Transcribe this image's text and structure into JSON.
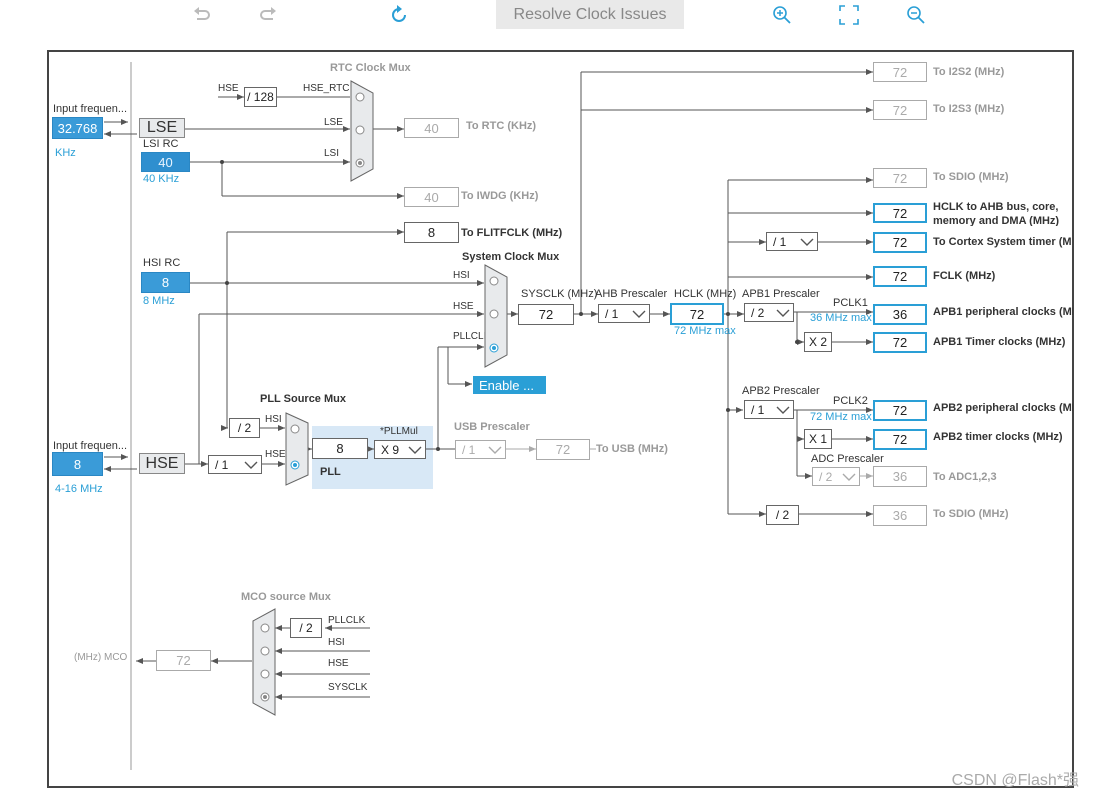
{
  "toolbar": {
    "undo_icon": "undo-icon",
    "redo_icon": "redo-icon",
    "refresh_icon": "refresh-icon",
    "resolve_label": "Resolve Clock Issues",
    "zoom_in_icon": "zoom-in-icon",
    "fit_icon": "fit-icon",
    "zoom_out_icon": "zoom-out-icon"
  },
  "inputs": {
    "lse_input_label": "Input frequen...",
    "lse_value": "32.768",
    "lse_unit": "KHz",
    "lse_name": "LSE",
    "lsi_rc_label": "LSI RC",
    "lsi_value": "40",
    "lsi_unit": "40 KHz",
    "hsi_rc_label": "HSI RC",
    "hsi_value": "8",
    "hsi_unit": "8 MHz",
    "hse_input_label": "Input frequen...",
    "hse_value": "8",
    "hse_unit": "4-16 MHz",
    "hse_name": "HSE"
  },
  "rtc": {
    "title": "RTC Clock Mux",
    "hse_label": "HSE",
    "div128": "/ 128",
    "hse_rtc": "HSE_RTC",
    "lse": "LSE",
    "lsi": "LSI",
    "rtc_value": "40",
    "rtc_label": "To RTC (KHz)",
    "iwdg_value": "40",
    "iwdg_label": "To IWDG (KHz)",
    "flit_value": "8",
    "flit_label": "To FLITFCLK (MHz)"
  },
  "sysmux": {
    "title": "System Clock Mux",
    "hsi": "HSI",
    "hse": "HSE",
    "pllclk": "PLLCLK",
    "enable": "Enable ..."
  },
  "pll": {
    "source_title": "PLL Source Mux",
    "div2": "/ 2",
    "hsi": "HSI",
    "hse": "HSE",
    "hse_div": "/ 1",
    "pll_in": "8",
    "pllmul_label": "*PLLMul",
    "pllmul": "X 9",
    "pll_label": "PLL",
    "usb_title": "USB Prescaler",
    "usb_div": "/ 1",
    "usb_value": "72",
    "usb_label": "To USB (MHz)"
  },
  "main": {
    "sysclk_label": "SYSCLK (MHz)",
    "sysclk": "72",
    "ahb_title": "AHB Prescaler",
    "ahb_div": "/ 1",
    "hclk_label": "HCLK (MHz)",
    "hclk": "72",
    "hclk_max": "72 MHz max"
  },
  "outputs": {
    "i2s2_value": "72",
    "i2s2_label": "To I2S2 (MHz)",
    "i2s3_value": "72",
    "i2s3_label": "To I2S3 (MHz)",
    "sdio1_value": "72",
    "sdio1_label": "To SDIO (MHz)",
    "ahb_value": "72",
    "ahb_label_1": "HCLK to AHB bus, core,",
    "ahb_label_2": "memory and DMA (MHz)",
    "cortex_div": "/ 1",
    "cortex_value": "72",
    "cortex_label": "To Cortex System timer (M",
    "fclk_value": "72",
    "fclk_label": "FCLK (MHz)",
    "apb1_title": "APB1 Prescaler",
    "apb1_div": "/ 2",
    "pclk1": "PCLK1",
    "pclk1_max": "36 MHz max",
    "apb1_periph_value": "36",
    "apb1_periph_label": "APB1 peripheral clocks (MH",
    "apb1_x2": "X 2",
    "apb1_timer_value": "72",
    "apb1_timer_label": "APB1 Timer clocks (MHz)",
    "apb2_title": "APB2 Prescaler",
    "apb2_div": "/ 1",
    "pclk2": "PCLK2",
    "pclk2_max": "72 MHz max",
    "apb2_periph_value": "72",
    "apb2_periph_label": "APB2 peripheral clocks (MH",
    "apb2_x1": "X 1",
    "apb2_timer_value": "72",
    "apb2_timer_label": "APB2 timer clocks (MHz)",
    "adc_title": "ADC Prescaler",
    "adc_div": "/ 2",
    "adc_value": "36",
    "adc_label": "To ADC1,2,3",
    "sdio2_div": "/ 2",
    "sdio2_value": "36",
    "sdio2_label": "To SDIO (MHz)"
  },
  "mco": {
    "title": "MCO source Mux",
    "div2": "/ 2",
    "pllclk": "PLLCLK",
    "hsi": "HSI",
    "hse": "HSE",
    "sysclk": "SYSCLK",
    "value": "72",
    "label": "(MHz) MCO"
  },
  "watermark": "CSDN @Flash*强",
  "colors": {
    "accent": "#2a9fd6",
    "line": "#555555",
    "disabled": "#aaaaaa"
  }
}
